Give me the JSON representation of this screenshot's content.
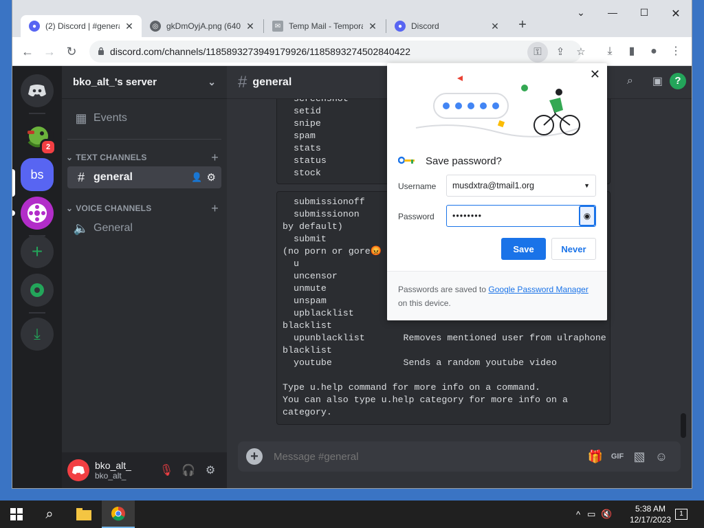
{
  "browser": {
    "tabs": [
      {
        "title": "(2) Discord | #general | bko_alt_'s server",
        "active": true
      },
      {
        "title": "gkDmOyjA.png (640×",
        "active": false
      },
      {
        "title": "Temp Mail - Temporary",
        "active": false
      },
      {
        "title": "Discord",
        "active": false
      }
    ],
    "url": "discord.com/channels/1185893273949179926/1185893274502840422"
  },
  "discord": {
    "server_name": "bko_alt_'s server",
    "guild_badge": "2",
    "server_initials": "bs",
    "events_label": "Events",
    "text_category": "TEXT CHANNELS",
    "voice_category": "VOICE CHANNELS",
    "text_channel": "general",
    "voice_channel": "General",
    "header_channel": "general",
    "user": {
      "display": "bko_alt_",
      "username": "bko_alt_"
    },
    "composer_placeholder": "Message #general",
    "code_block_1": "  screenshot\n  setid\n  snipe\n  spam\n  stats\n  status\n  stock",
    "code_block_2": "  submissionoff\n  submissionon                                          d\nby default)\n  submit                                                d\n(no porn or gore😡\n  u\n  uncensor\n  unmute\n  unspam\n  upblacklist\nblacklist\n  upunblacklist       Removes mentioned user from ulraphone\nblacklist\n  youtube             Sends a random youtube video\n\nType u.help command for more info on a command.\nYou can also type u.help category for more info on a\ncategory."
  },
  "password_popup": {
    "title": "Save password?",
    "username_label": "Username",
    "username_value": "musdxtra@tmail1.org",
    "password_label": "Password",
    "password_value": "••••••••",
    "save_label": "Save",
    "never_label": "Never",
    "footer_text_1": "Passwords are saved to ",
    "footer_link": "Google Password Manager",
    "footer_text_2": " on this device."
  },
  "taskbar": {
    "time": "5:38 AM",
    "date": "12/17/2023",
    "notifications": "1"
  },
  "colors": {
    "discord_blurple": "#5865f2",
    "discord_green": "#23a55a",
    "chrome_blue": "#1a73e8"
  }
}
